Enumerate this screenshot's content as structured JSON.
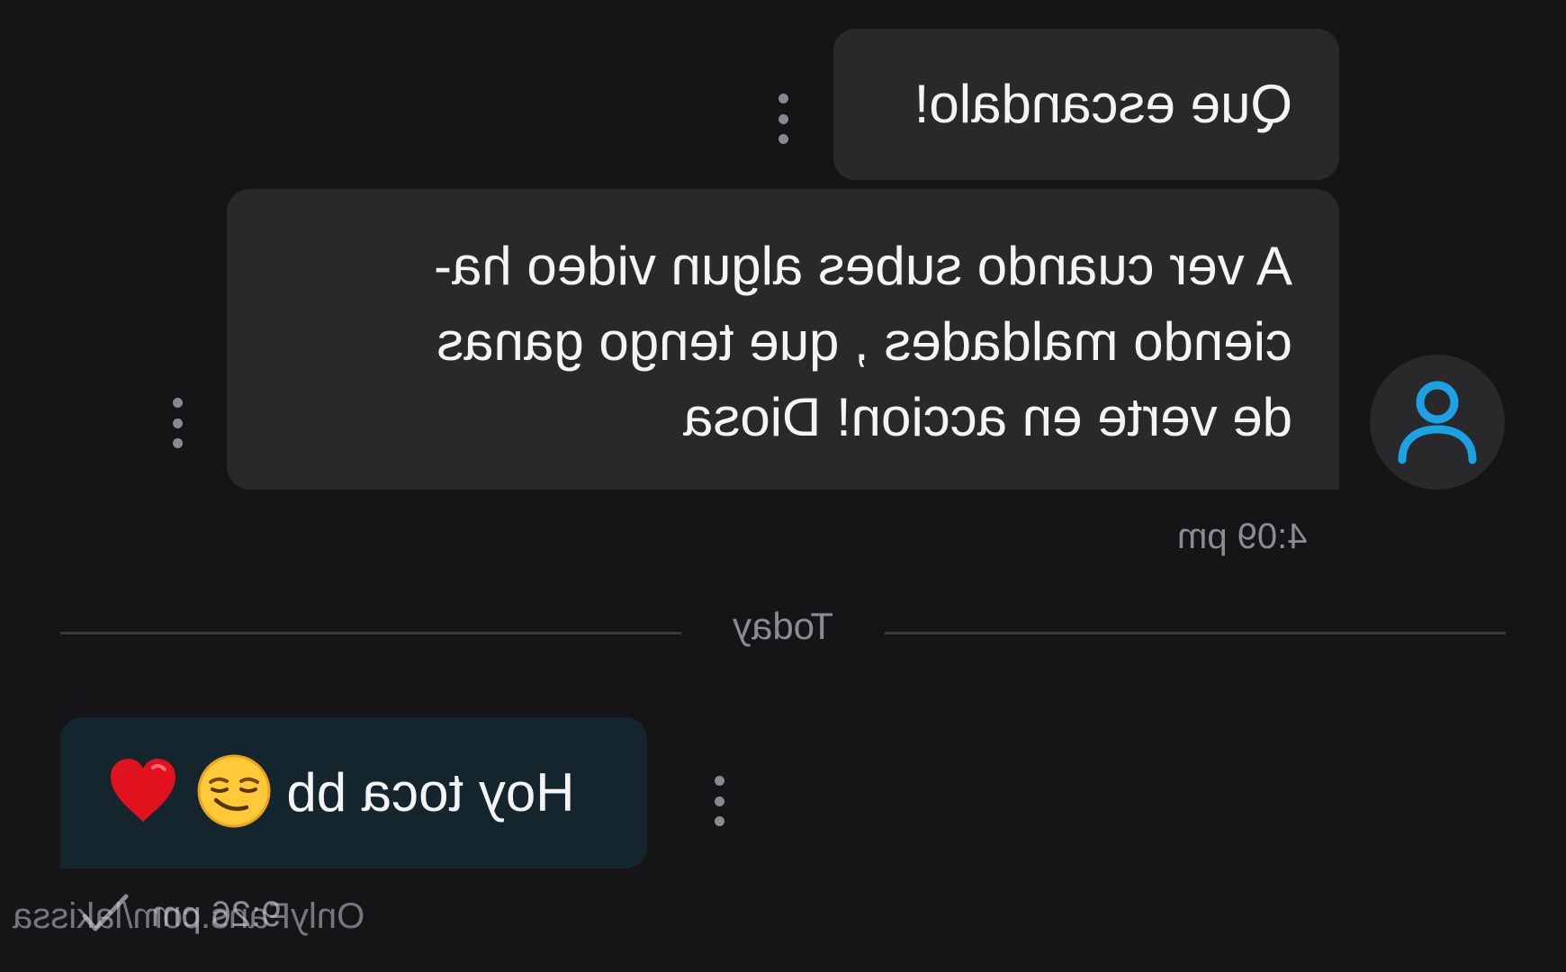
{
  "messages": [
    {
      "text": "Que escandalo!",
      "direction": "incoming"
    },
    {
      "text": "A ver cuando subes algun video ha-\nciendo maldades , que tengo ganas\nde verte en accion! Diosa",
      "direction": "incoming",
      "time": "4:09 pm"
    },
    {
      "text": "Hoy toca bb",
      "emojis": [
        "smirking-face-emoji",
        "red-heart-emoji"
      ],
      "direction": "outgoing",
      "time": "9:26 pm"
    }
  ],
  "divider": {
    "label": "Today"
  },
  "watermark": "OnlyFans.com/lakissa",
  "icons": {
    "avatar": "user-icon",
    "menu": "more-vertical-icon",
    "read_receipt": "checkmark-icon"
  },
  "colors": {
    "background": "#151517",
    "incoming_bubble": "#29292b",
    "outgoing_bubble": "#15252e",
    "accent": "#1da1e2",
    "secondary_text": "#8c8c90"
  }
}
